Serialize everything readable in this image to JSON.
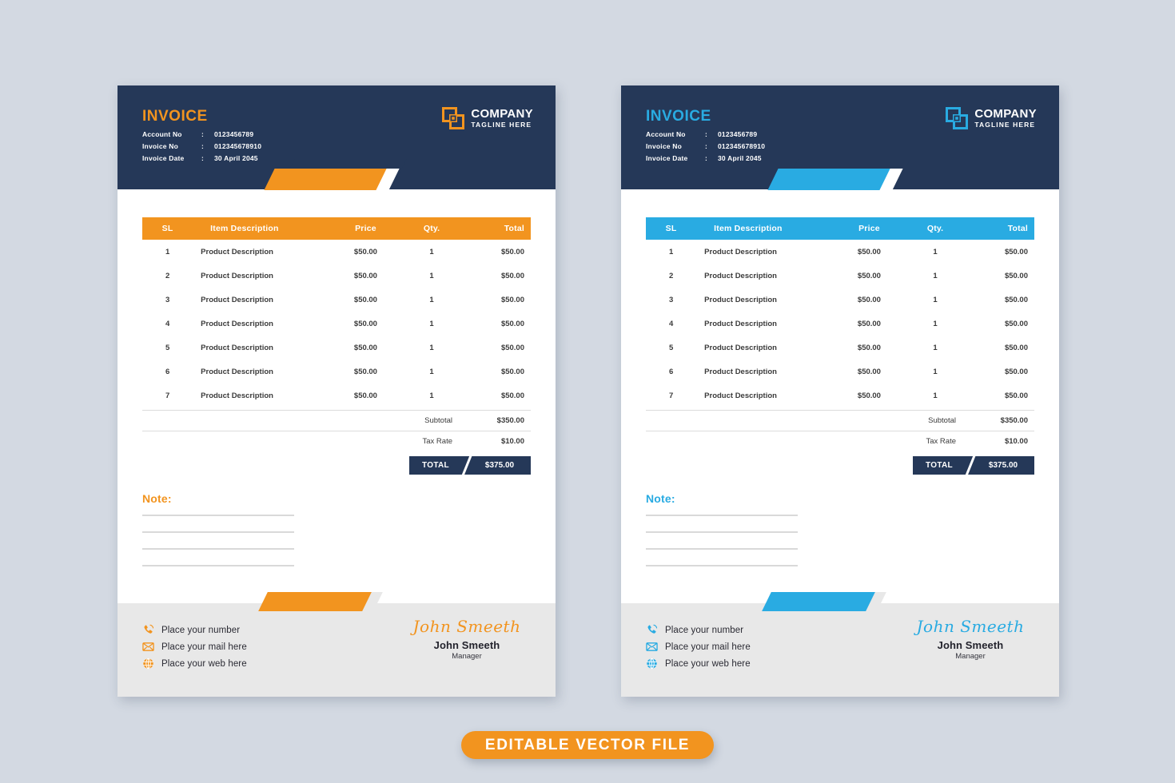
{
  "page": {
    "background_color": "#d3d9e2",
    "banner": {
      "label": "EDITABLE VECTOR  FILE",
      "color": "#f2941f"
    }
  },
  "colors": {
    "navy": "#253858",
    "orange": "#f2941f",
    "blue": "#29abe2",
    "footer_gray": "#e8e8e8"
  },
  "invoices": [
    {
      "variant": "orange",
      "accent_color": "#f2941f",
      "header": {
        "title": "INVOICE",
        "meta": [
          {
            "label": "Account No",
            "separator": ":",
            "value": "0123456789"
          },
          {
            "label": "Invoice No",
            "separator": ":",
            "value": "012345678910"
          },
          {
            "label": "Invoice Date",
            "separator": ":",
            "value": "30 April 2045"
          }
        ],
        "brand": {
          "logo_icon": "overlapping-squares-icon",
          "name": "COMPANY",
          "tagline": "TAGLINE HERE"
        }
      },
      "table": {
        "columns": [
          "SL",
          "Item Description",
          "Price",
          "Qty.",
          "Total"
        ],
        "rows": [
          {
            "sl": "1",
            "description": "Product Description",
            "price": "$50.00",
            "qty": "1",
            "total": "$50.00"
          },
          {
            "sl": "2",
            "description": "Product Description",
            "price": "$50.00",
            "qty": "1",
            "total": "$50.00"
          },
          {
            "sl": "3",
            "description": "Product Description",
            "price": "$50.00",
            "qty": "1",
            "total": "$50.00"
          },
          {
            "sl": "4",
            "description": "Product Description",
            "price": "$50.00",
            "qty": "1",
            "total": "$50.00"
          },
          {
            "sl": "5",
            "description": "Product Description",
            "price": "$50.00",
            "qty": "1",
            "total": "$50.00"
          },
          {
            "sl": "6",
            "description": "Product Description",
            "price": "$50.00",
            "qty": "1",
            "total": "$50.00"
          },
          {
            "sl": "7",
            "description": "Product Description",
            "price": "$50.00",
            "qty": "1",
            "total": "$50.00"
          }
        ]
      },
      "summary": {
        "subtotal_label": "Subtotal",
        "subtotal_value": "$350.00",
        "tax_label": "Tax Rate",
        "tax_value": "$10.00",
        "total_label": "TOTAL",
        "total_value": "$375.00"
      },
      "note": {
        "title": "Note:",
        "line_count": 4
      },
      "footer": {
        "contacts": [
          {
            "icon": "phone-icon",
            "text": "Place your number"
          },
          {
            "icon": "envelope-icon",
            "text": "Place your mail here"
          },
          {
            "icon": "globe-icon",
            "text": "Place your web here"
          }
        ],
        "signature_script": "John Smeeth",
        "signature_name": "John Smeeth",
        "signature_role": "Manager"
      }
    },
    {
      "variant": "blue",
      "accent_color": "#29abe2",
      "header": {
        "title": "INVOICE",
        "meta": [
          {
            "label": "Account No",
            "separator": ":",
            "value": "0123456789"
          },
          {
            "label": "Invoice No",
            "separator": ":",
            "value": "012345678910"
          },
          {
            "label": "Invoice Date",
            "separator": ":",
            "value": "30 April 2045"
          }
        ],
        "brand": {
          "logo_icon": "overlapping-squares-icon",
          "name": "COMPANY",
          "tagline": "TAGLINE HERE"
        }
      },
      "table": {
        "columns": [
          "SL",
          "Item Description",
          "Price",
          "Qty.",
          "Total"
        ],
        "rows": [
          {
            "sl": "1",
            "description": "Product Description",
            "price": "$50.00",
            "qty": "1",
            "total": "$50.00"
          },
          {
            "sl": "2",
            "description": "Product Description",
            "price": "$50.00",
            "qty": "1",
            "total": "$50.00"
          },
          {
            "sl": "3",
            "description": "Product Description",
            "price": "$50.00",
            "qty": "1",
            "total": "$50.00"
          },
          {
            "sl": "4",
            "description": "Product Description",
            "price": "$50.00",
            "qty": "1",
            "total": "$50.00"
          },
          {
            "sl": "5",
            "description": "Product Description",
            "price": "$50.00",
            "qty": "1",
            "total": "$50.00"
          },
          {
            "sl": "6",
            "description": "Product Description",
            "price": "$50.00",
            "qty": "1",
            "total": "$50.00"
          },
          {
            "sl": "7",
            "description": "Product Description",
            "price": "$50.00",
            "qty": "1",
            "total": "$50.00"
          }
        ]
      },
      "summary": {
        "subtotal_label": "Subtotal",
        "subtotal_value": "$350.00",
        "tax_label": "Tax Rate",
        "tax_value": "$10.00",
        "total_label": "TOTAL",
        "total_value": "$375.00"
      },
      "note": {
        "title": "Note:",
        "line_count": 4
      },
      "footer": {
        "contacts": [
          {
            "icon": "phone-icon",
            "text": "Place your number"
          },
          {
            "icon": "envelope-icon",
            "text": "Place your mail here"
          },
          {
            "icon": "globe-icon",
            "text": "Place your web here"
          }
        ],
        "signature_script": "John Smeeth",
        "signature_name": "John Smeeth",
        "signature_role": "Manager"
      }
    }
  ]
}
